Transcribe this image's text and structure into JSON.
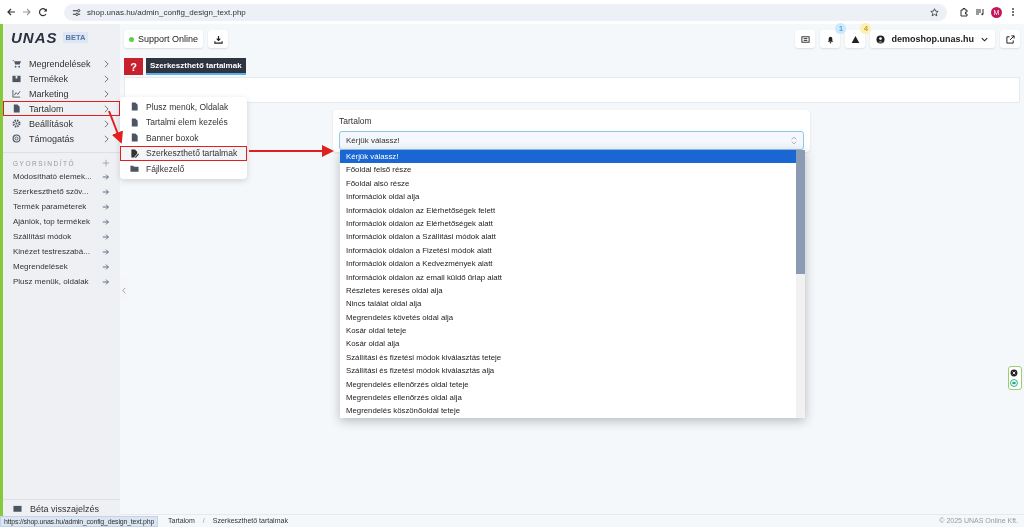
{
  "browser": {
    "url": "shop.unas.hu/admin_config_design_text.php",
    "profile_initial": "M"
  },
  "sidebar": {
    "logo": "UNAS",
    "logo_badge": "BETA",
    "items": [
      {
        "label": "Megrendelések",
        "highlighted": false
      },
      {
        "label": "Termékek",
        "highlighted": false
      },
      {
        "label": "Marketing",
        "highlighted": false
      },
      {
        "label": "Tartalom",
        "highlighted": true
      },
      {
        "label": "Beállítások",
        "highlighted": false
      },
      {
        "label": "Támogatás",
        "highlighted": false
      }
    ],
    "quick_title": "GYORSINDÍTÓ",
    "quick_links": [
      "Módosítható elemek...",
      "Szerkeszthető szöv...",
      "Termék paraméterek",
      "Ajánlók, top termékek",
      "Szállítási módok",
      "Kinézet testreszabá...",
      "Megrendelések",
      "Plusz menük, oldalak"
    ],
    "feedback": "Béta visszajelzés"
  },
  "submenu": [
    {
      "label": "Plusz menük, Oldalak",
      "highlighted": false
    },
    {
      "label": "Tartalmi elem kezelés",
      "highlighted": false
    },
    {
      "label": "Banner boxok",
      "highlighted": false
    },
    {
      "label": "Szerkeszthető tartalmak",
      "highlighted": true
    },
    {
      "label": "Fájlkezelő",
      "highlighted": false
    }
  ],
  "topbar": {
    "support": "Support Online",
    "notifications": "1",
    "warnings": "4",
    "shop": "demoshop.unas.hu"
  },
  "page": {
    "help": "?",
    "title": "Szerkeszthető tartalmak"
  },
  "form": {
    "label": "Tartalom",
    "value": "Kérjük válassz!",
    "options": [
      {
        "label": "Kérjük válassz!",
        "selected": true
      },
      {
        "label": "Főoldal felső része",
        "selected": false
      },
      {
        "label": "Főoldal alsó része",
        "selected": false
      },
      {
        "label": "Információk oldal alja",
        "selected": false
      },
      {
        "label": "Információk oldalon az Elérhetőségek felett",
        "selected": false
      },
      {
        "label": "Információk oldalon az Elérhetőségek alatt",
        "selected": false
      },
      {
        "label": "Információk oldalon a Szállítási módok alatt",
        "selected": false
      },
      {
        "label": "Információk oldalon a Fizetési módok alatt",
        "selected": false
      },
      {
        "label": "Információk oldalon a Kedvezmények alatt",
        "selected": false
      },
      {
        "label": "Információk oldalon az email küldő űrlap alatt",
        "selected": false
      },
      {
        "label": "Részletes keresés oldal alja",
        "selected": false
      },
      {
        "label": "Nincs találat oldal alja",
        "selected": false
      },
      {
        "label": "Megrendelés követés oldal alja",
        "selected": false
      },
      {
        "label": "Kosár oldal teteje",
        "selected": false
      },
      {
        "label": "Kosár oldal alja",
        "selected": false
      },
      {
        "label": "Szállítási és fizetési módok kiválasztás teteje",
        "selected": false
      },
      {
        "label": "Szállítási és fizetési módok kiválasztás alja",
        "selected": false
      },
      {
        "label": "Megrendelés ellenőrzés oldal teteje",
        "selected": false
      },
      {
        "label": "Megrendelés ellenőrzés oldal alja",
        "selected": false
      },
      {
        "label": "Megrendelés köszönőoldal teteje",
        "selected": false
      }
    ]
  },
  "breadcrumb": {
    "items": [
      "Tartalom",
      "Szerkeszthető tartalmak"
    ],
    "separator": "/"
  },
  "footer": "© 2025 UNAS Online Kft.",
  "status_url": "https://shop.unas.hu/admin_config_design_text.php"
}
